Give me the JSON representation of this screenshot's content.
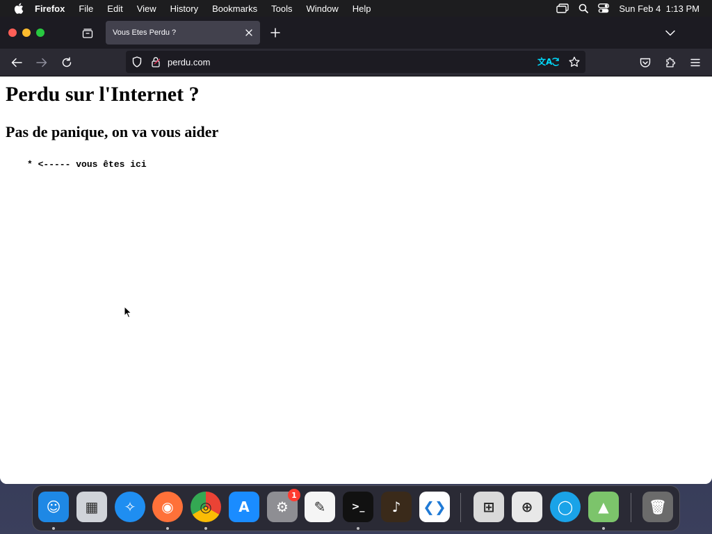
{
  "menubar": {
    "apple_icon": "apple-logo",
    "app_name": "Firefox",
    "items": [
      "File",
      "Edit",
      "View",
      "History",
      "Bookmarks",
      "Tools",
      "Window",
      "Help"
    ],
    "clock": "Sun Feb 4  1:13 PM",
    "status_icons": [
      "screen-mirroring-icon",
      "spotlight-search-icon",
      "control-center-icon"
    ]
  },
  "browser": {
    "tab": {
      "title": "Vous Etes Perdu ?"
    },
    "url": "perdu.com"
  },
  "page": {
    "h1": "Perdu sur l'Internet ?",
    "h2": "Pas de panique, on va vous aider",
    "pre": "* <----- vous êtes ici"
  },
  "dock": {
    "apps": [
      {
        "name": "Finder",
        "icon": "finder-icon",
        "color": "#1e88e5",
        "running": true
      },
      {
        "name": "Launchpad",
        "icon": "launchpad-icon",
        "color": "#d0d3d9",
        "running": false
      },
      {
        "name": "Safari",
        "icon": "safari-icon",
        "color": "#1f8ef1",
        "running": false
      },
      {
        "name": "Firefox",
        "icon": "firefox-icon",
        "color": "#ff7139",
        "running": true
      },
      {
        "name": "Chrome",
        "icon": "chrome-icon",
        "color": "#ffffff",
        "running": true
      },
      {
        "name": "App Store",
        "icon": "app-store-icon",
        "color": "#1a8cff",
        "running": false
      },
      {
        "name": "System Settings",
        "icon": "system-settings-icon",
        "color": "#8e8e93",
        "running": false,
        "badge": "1"
      },
      {
        "name": "TextEdit",
        "icon": "textedit-icon",
        "color": "#f5f5f5",
        "running": false
      },
      {
        "name": "Terminal",
        "icon": "terminal-icon",
        "color": "#111111",
        "running": true
      },
      {
        "name": "GarageBand",
        "icon": "garageband-icon",
        "color": "#3a2a1a",
        "running": false
      },
      {
        "name": "Visual Studio Code",
        "icon": "vscode-icon",
        "color": "#ffffff",
        "running": false
      },
      {
        "name": "Boot Camp Assistant",
        "icon": "bootcamp-icon",
        "color": "#d9d9d9",
        "running": false
      },
      {
        "name": "Disk Utility",
        "icon": "disk-utility-icon",
        "color": "#e8e8e8",
        "running": false
      },
      {
        "name": "Proxyman",
        "icon": "proxyman-icon",
        "color": "#1aa3e8",
        "running": false
      },
      {
        "name": "macOS Sonoma Installer",
        "icon": "macos-installer-icon",
        "color": "#7cc46b",
        "running": true
      },
      {
        "name": "Trash",
        "icon": "trash-icon",
        "color": "#6b6b6b",
        "running": false
      }
    ]
  }
}
